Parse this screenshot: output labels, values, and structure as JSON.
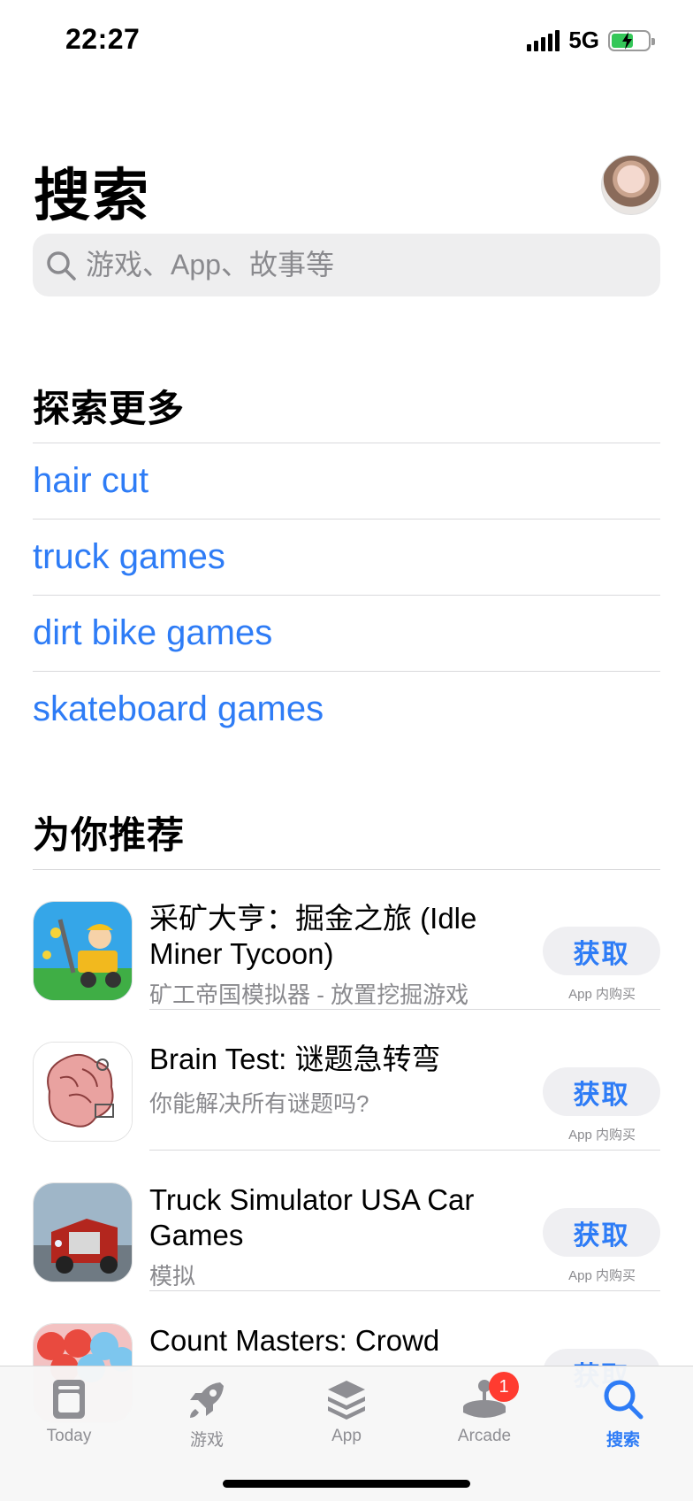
{
  "status_bar": {
    "time": "22:27",
    "network": "5G"
  },
  "header": {
    "title": "搜索"
  },
  "search": {
    "placeholder": "游戏、App、故事等"
  },
  "explore": {
    "title": "探索更多",
    "items": [
      "hair cut",
      "truck games",
      "dirt bike games",
      "skateboard games"
    ]
  },
  "recommend": {
    "title": "为你推荐",
    "items": [
      {
        "name": "采矿大亨：掘金之旅 (Idle Miner Tycoon)",
        "subtitle": "矿工帝国模拟器 - 放置挖掘游戏",
        "button": "获取",
        "iap": "App 内购买",
        "icon": "idle-miner-icon"
      },
      {
        "name": "Brain Test: 谜题急转弯",
        "subtitle": "你能解决所有谜题吗?",
        "button": "获取",
        "iap": "App 内购买",
        "icon": "brain-test-icon"
      },
      {
        "name": "Truck Simulator USA Car Games",
        "subtitle": "模拟",
        "button": "获取",
        "iap": "App 内购买",
        "icon": "truck-simulator-icon"
      },
      {
        "name": "Count Masters: Crowd",
        "subtitle": "",
        "button": "获取",
        "iap": "",
        "icon": "count-masters-icon"
      }
    ]
  },
  "tabs": [
    {
      "label": "Today",
      "icon": "today-icon",
      "active": false
    },
    {
      "label": "游戏",
      "icon": "rocket-icon",
      "active": false
    },
    {
      "label": "App",
      "icon": "layers-icon",
      "active": false
    },
    {
      "label": "Arcade",
      "icon": "joystick-icon",
      "active": false,
      "badge": "1"
    },
    {
      "label": "搜索",
      "icon": "search-icon",
      "active": true
    }
  ],
  "colors": {
    "accent": "#2e7cf6",
    "badge": "#ff3b30",
    "battery": "#35c759"
  }
}
